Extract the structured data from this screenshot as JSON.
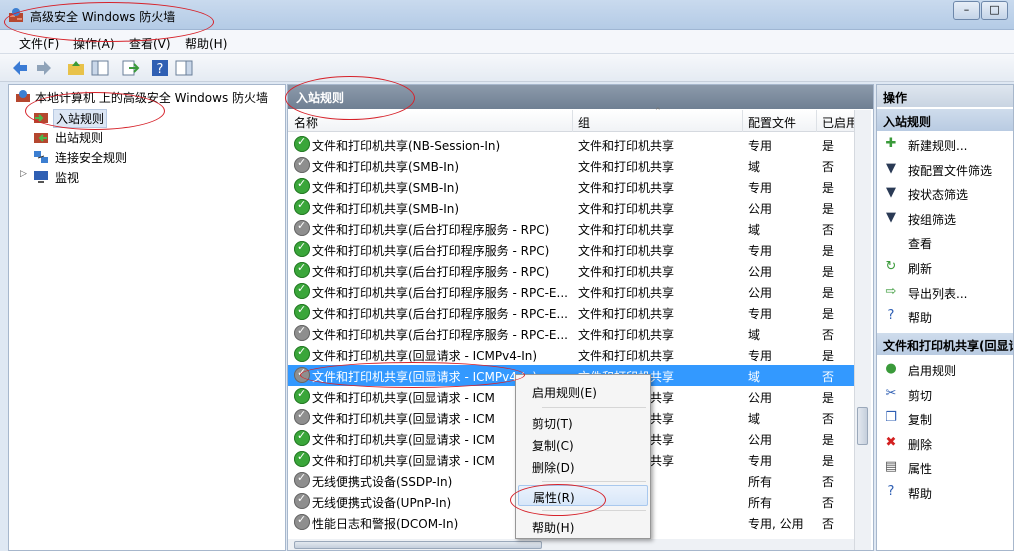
{
  "window": {
    "title": "高级安全 Windows 防火墙",
    "minimize": "–",
    "maximize": "□"
  },
  "menubar": [
    "文件(F)",
    "操作(A)",
    "查看(V)",
    "帮助(H)"
  ],
  "left_tree": {
    "root": "本地计算机 上的高级安全 Windows 防火墙",
    "items": [
      "入站规则",
      "出站规则",
      "连接安全规则",
      "监视"
    ]
  },
  "center": {
    "title": "入站规则",
    "columns": [
      "名称",
      "组",
      "配置文件",
      "已启用"
    ],
    "rows": [
      {
        "name": "文件和打印机共享(NB-Session-In)",
        "group": "文件和打印机共享",
        "profile": "专用",
        "enabled": "是",
        "status": "on"
      },
      {
        "name": "文件和打印机共享(SMB-In)",
        "group": "文件和打印机共享",
        "profile": "域",
        "enabled": "否",
        "status": "off"
      },
      {
        "name": "文件和打印机共享(SMB-In)",
        "group": "文件和打印机共享",
        "profile": "专用",
        "enabled": "是",
        "status": "on"
      },
      {
        "name": "文件和打印机共享(SMB-In)",
        "group": "文件和打印机共享",
        "profile": "公用",
        "enabled": "是",
        "status": "on"
      },
      {
        "name": "文件和打印机共享(后台打印程序服务 - RPC)",
        "group": "文件和打印机共享",
        "profile": "域",
        "enabled": "否",
        "status": "off"
      },
      {
        "name": "文件和打印机共享(后台打印程序服务 - RPC)",
        "group": "文件和打印机共享",
        "profile": "专用",
        "enabled": "是",
        "status": "on"
      },
      {
        "name": "文件和打印机共享(后台打印程序服务 - RPC)",
        "group": "文件和打印机共享",
        "profile": "公用",
        "enabled": "是",
        "status": "on"
      },
      {
        "name": "文件和打印机共享(后台打印程序服务 - RPC-E...",
        "group": "文件和打印机共享",
        "profile": "公用",
        "enabled": "是",
        "status": "on"
      },
      {
        "name": "文件和打印机共享(后台打印程序服务 - RPC-E...",
        "group": "文件和打印机共享",
        "profile": "专用",
        "enabled": "是",
        "status": "on"
      },
      {
        "name": "文件和打印机共享(后台打印程序服务 - RPC-E...",
        "group": "文件和打印机共享",
        "profile": "域",
        "enabled": "否",
        "status": "off"
      },
      {
        "name": "文件和打印机共享(回显请求 - ICMPv4-In)",
        "group": "文件和打印机共享",
        "profile": "专用",
        "enabled": "是",
        "status": "on"
      },
      {
        "name": "文件和打印机共享(回显请求 - ICMPv4-In)",
        "group": "文件和打印机共享",
        "profile": "域",
        "enabled": "否",
        "status": "off",
        "selected": true
      },
      {
        "name": "文件和打印机共享(回显请求 - ICM",
        "group": "文件和打印机共享",
        "profile": "公用",
        "enabled": "是",
        "status": "on"
      },
      {
        "name": "文件和打印机共享(回显请求 - ICM",
        "group": "文件和打印机共享",
        "profile": "域",
        "enabled": "否",
        "status": "off"
      },
      {
        "name": "文件和打印机共享(回显请求 - ICM",
        "group": "文件和打印机共享",
        "profile": "公用",
        "enabled": "是",
        "status": "on"
      },
      {
        "name": "文件和打印机共享(回显请求 - ICM",
        "group": "文件和打印机共享",
        "profile": "专用",
        "enabled": "是",
        "status": "on"
      },
      {
        "name": "无线便携式设备(SSDP-In)",
        "group": "",
        "profile": "所有",
        "enabled": "否",
        "status": "off"
      },
      {
        "name": "无线便携式设备(UPnP-In)",
        "group": "",
        "profile": "所有",
        "enabled": "否",
        "status": "off"
      },
      {
        "name": "性能日志和警报(DCOM-In)",
        "group": "报",
        "profile": "专用, 公用",
        "enabled": "否",
        "status": "off"
      }
    ]
  },
  "context_menu": {
    "items": [
      "启用规则(E)",
      "剪切(T)",
      "复制(C)",
      "删除(D)",
      "属性(R)",
      "帮助(H)"
    ],
    "hovered": "属性(R)"
  },
  "actions_pane": {
    "title": "操作",
    "section1": "入站规则",
    "section1_items": [
      {
        "label": "新建规则...",
        "icon": "new-rule-icon"
      },
      {
        "label": "按配置文件筛选",
        "icon": "filter-icon"
      },
      {
        "label": "按状态筛选",
        "icon": "filter-icon"
      },
      {
        "label": "按组筛选",
        "icon": "filter-icon"
      },
      {
        "label": "查看",
        "icon": "view-icon"
      },
      {
        "label": "刷新",
        "icon": "refresh-icon"
      },
      {
        "label": "导出列表...",
        "icon": "export-icon"
      },
      {
        "label": "帮助",
        "icon": "help-icon"
      }
    ],
    "section2": "文件和打印机共享(回显请",
    "section2_items": [
      {
        "label": "启用规则",
        "icon": "enable-icon"
      },
      {
        "label": "剪切",
        "icon": "cut-icon"
      },
      {
        "label": "复制",
        "icon": "copy-icon"
      },
      {
        "label": "删除",
        "icon": "delete-icon"
      },
      {
        "label": "属性",
        "icon": "properties-icon"
      },
      {
        "label": "帮助",
        "icon": "help-icon"
      }
    ]
  },
  "colors": {
    "selection": "#3399ff",
    "enabled_icon": "#3aa63a",
    "disabled_icon": "#8e8e8e",
    "annotation": "#d6222a",
    "pane_header": "#6f7f93"
  }
}
